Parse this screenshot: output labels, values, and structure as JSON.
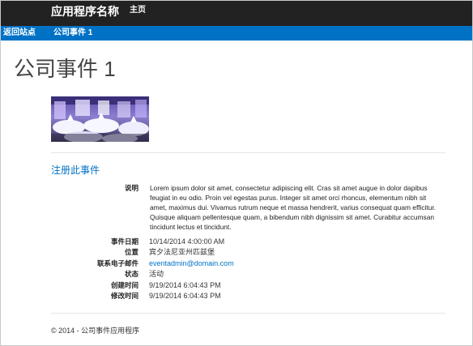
{
  "header": {
    "app_name": "应用程序名称",
    "home": "主页"
  },
  "breadcrumb": {
    "back": "返回站点",
    "separator": "▸",
    "current": "公司事件 1"
  },
  "page": {
    "title": "公司事件 1",
    "register_link": "注册此事件"
  },
  "details": {
    "description": {
      "label": "说明",
      "value": "Lorem ipsum dolor sit amet, consectetur adipiscing elit. Cras sit amet augue in dolor dapibus feugiat in eu odio. Proin vel egestas purus. Integer sit amet orci rhoncus, elementum nibh sit amet, maximus dui. Vivamus rutrum neque et massa hendrerit, varius consequat quam efficitur. Quisque aliquam pellentesque quam, a bibendum nibh dignissim sit amet. Curabitur accumsan tincidunt lectus et tincidunt."
    },
    "event_date": {
      "label": "事件日期",
      "value": "10/14/2014 4:00:00 AM"
    },
    "location": {
      "label": "位置",
      "value": "宾夕法尼亚州匹兹堡"
    },
    "email": {
      "label": "联系电子邮件",
      "value": "eventadmin@domain.com"
    },
    "status": {
      "label": "状态",
      "value": "活动"
    },
    "created": {
      "label": "创建时间",
      "value": "9/19/2014 6:04:43 PM"
    },
    "modified": {
      "label": "修改时间",
      "value": "9/19/2014 6:04:43 PM"
    }
  },
  "footer": {
    "text": "© 2014 - 公司事件应用程序"
  }
}
